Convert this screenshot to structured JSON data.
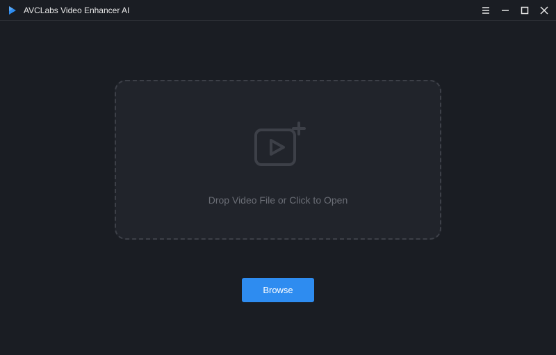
{
  "header": {
    "app_title": "AVCLabs Video Enhancer AI"
  },
  "dropzone": {
    "prompt_text": "Drop Video File or Click to Open"
  },
  "actions": {
    "browse_label": "Browse"
  }
}
